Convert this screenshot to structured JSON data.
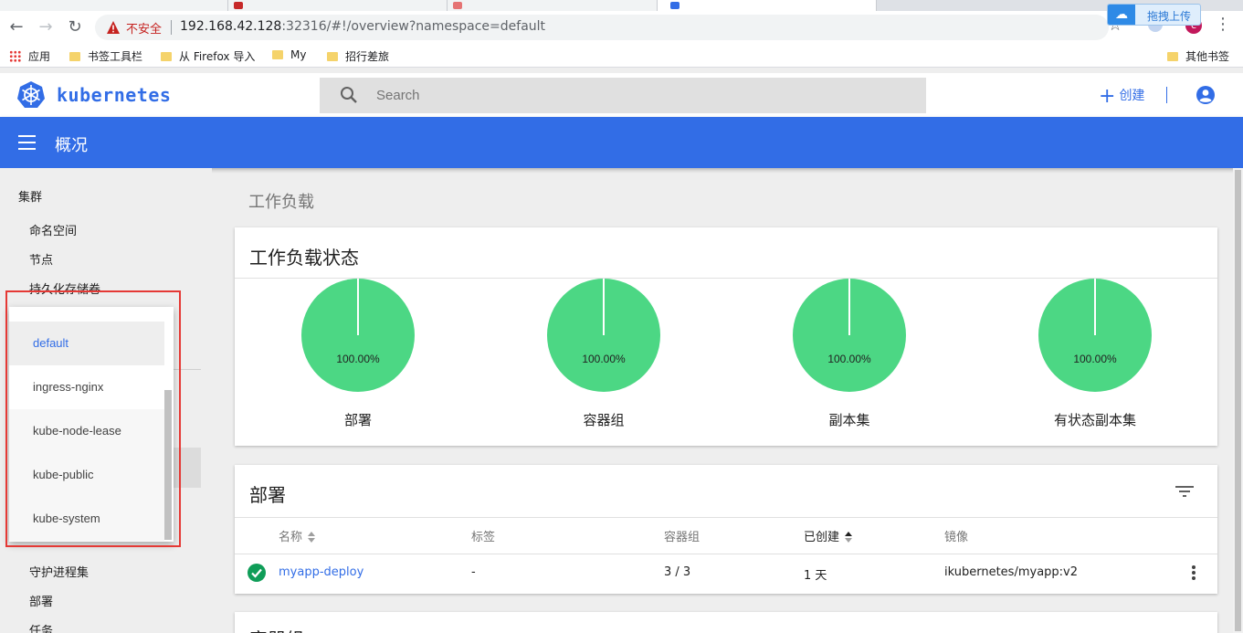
{
  "browser": {
    "insecure_label": "不安全",
    "url_host": "192.168.42.128",
    "url_rest": ":32316/#!/overview?namespace=default",
    "upload_label": "拖拽上传",
    "profile_letter": "c",
    "bookmarks": [
      "应用",
      "书签工具栏",
      "从 Firefox 导入",
      "My",
      "招行差旅"
    ],
    "other_bookmarks": "其他书签"
  },
  "header": {
    "brand": "kubernetes",
    "search_placeholder": "Search",
    "create_label": "创建"
  },
  "toolbar": {
    "title": "概况"
  },
  "sidebar": {
    "cluster_heading": "集群",
    "cluster_items": [
      "命名空间",
      "节点",
      "持久化存储卷"
    ],
    "workload_items": [
      "守护进程集",
      "部署",
      "任务"
    ]
  },
  "namespace_dropdown": {
    "options": [
      "default",
      "ingress-nginx",
      "kube-node-lease",
      "kube-public",
      "kube-system"
    ],
    "selected": "default"
  },
  "main": {
    "section_title": "工作负载",
    "status_card": {
      "title": "工作负载状态",
      "charts": [
        {
          "label": "部署",
          "percent_text": "100.00%",
          "running": 100
        },
        {
          "label": "容器组",
          "percent_text": "100.00%",
          "running": 100
        },
        {
          "label": "副本集",
          "percent_text": "100.00%",
          "running": 100
        },
        {
          "label": "有状态副本集",
          "percent_text": "100.00%",
          "running": 100
        }
      ],
      "color": "#4cd784"
    },
    "deployments_card": {
      "title": "部署",
      "columns": [
        "名称",
        "标签",
        "容器组",
        "已创建",
        "镜像"
      ],
      "rows": [
        {
          "name": "myapp-deploy",
          "labels": "-",
          "pods": "3 / 3",
          "created": "1 天",
          "image": "ikubernetes/myapp:v2"
        }
      ]
    },
    "next_card_title": "容器组"
  },
  "colors": {
    "accent": "#326de6",
    "ok": "#0f9d58",
    "chart": "#4cd784",
    "highlight": "#e53935"
  }
}
